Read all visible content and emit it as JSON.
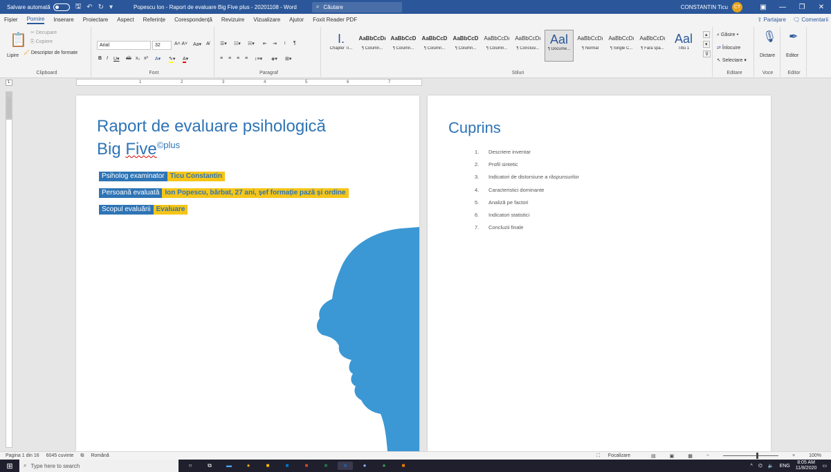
{
  "titlebar": {
    "autosave": "Salvare automată",
    "doc_title": "Popescu Ion - Raport de evaluare Big Five plus - 20201108 - Word",
    "search": "Căutare",
    "user": "CONSTANTIN Ticu",
    "user_initials": "CT"
  },
  "tabs": [
    "Fișier",
    "Pornire",
    "Inserare",
    "Proiectare",
    "Aspect",
    "Referințe",
    "Corespondență",
    "Revizuire",
    "Vizualizare",
    "Ajutor",
    "Foxit Reader PDF"
  ],
  "tabs_active": "Pornire",
  "share": "Partajare",
  "comments": "Comentarii",
  "ribbon": {
    "clipboard": {
      "label": "Clipboard",
      "paste": "Lipire",
      "cut": "Decupare",
      "copy": "Copiere",
      "format_painter": "Descriptor de formate"
    },
    "font": {
      "label": "Font",
      "family": "Arial",
      "size": "32"
    },
    "paragraph": {
      "label": "Paragraf"
    },
    "styles": {
      "label": "Stiluri",
      "items": [
        {
          "sample": "I.",
          "name": "Chapter Ti..."
        },
        {
          "sample": "AaBbCcDı",
          "name": "¶ Column..."
        },
        {
          "sample": "AaBbCcD",
          "name": "¶ Column..."
        },
        {
          "sample": "AaBbCcD",
          "name": "¶ Column..."
        },
        {
          "sample": "AaBbCcD",
          "name": "¶ Column..."
        },
        {
          "sample": "AaBbCcDı",
          "name": "¶ Column..."
        },
        {
          "sample": "AaBbCcDı",
          "name": "¶ Conclusi..."
        },
        {
          "sample": "Aal",
          "name": "¶ Docume..."
        },
        {
          "sample": "AaBbCcDı",
          "name": "¶ Normal"
        },
        {
          "sample": "AaBbCcDı",
          "name": "¶ Single C..."
        },
        {
          "sample": "AaBbCcDı",
          "name": "¶ Fără spa..."
        },
        {
          "sample": "Aal",
          "name": "Titlu 1"
        }
      ]
    },
    "editing": {
      "label": "Editare",
      "find": "Găsire",
      "replace": "Înlocuire",
      "select": "Selectare"
    },
    "voice": {
      "label": "Voce",
      "dictate": "Dictare"
    },
    "editor": {
      "label": "Editor",
      "editor": "Editor"
    }
  },
  "page1": {
    "title": "Raport de evaluare psihologică",
    "subtitle_main": "Big ",
    "subtitle_squiggle": "Five",
    "subtitle_sup": "©plus",
    "rows": [
      {
        "label": "Psiholog examinator",
        "value": "Ticu Constantin"
      },
      {
        "label": "Persoană evaluată",
        "value": "Ion Popescu, bărbat, 27 ani, șef formație pază și ordine"
      },
      {
        "label": "Scopul evaluării",
        "value": "Evaluare"
      }
    ]
  },
  "page2": {
    "title": "Cuprins",
    "toc": [
      {
        "num": "1.",
        "text": "Descriere inventar"
      },
      {
        "num": "2.",
        "text": "Profil sintetic"
      },
      {
        "num": "3.",
        "text": "Indicatori de distorsiune a răspunsurilor"
      },
      {
        "num": "4.",
        "text": "Caracteristici dominante"
      },
      {
        "num": "5.",
        "text": "Analiză pe factori"
      },
      {
        "num": "6.",
        "text": "Indicatori statistici"
      },
      {
        "num": "7.",
        "text": "Concluzii finale"
      }
    ]
  },
  "status": {
    "page": "Pagina 1 din 16",
    "words": "6045 cuvinte",
    "language": "Română",
    "focus": "Focalizare",
    "zoom": "100%"
  },
  "taskbar": {
    "search": "Type here to search",
    "lang": "ENG",
    "time": "8:05 AM",
    "date": "11/8/2020"
  }
}
